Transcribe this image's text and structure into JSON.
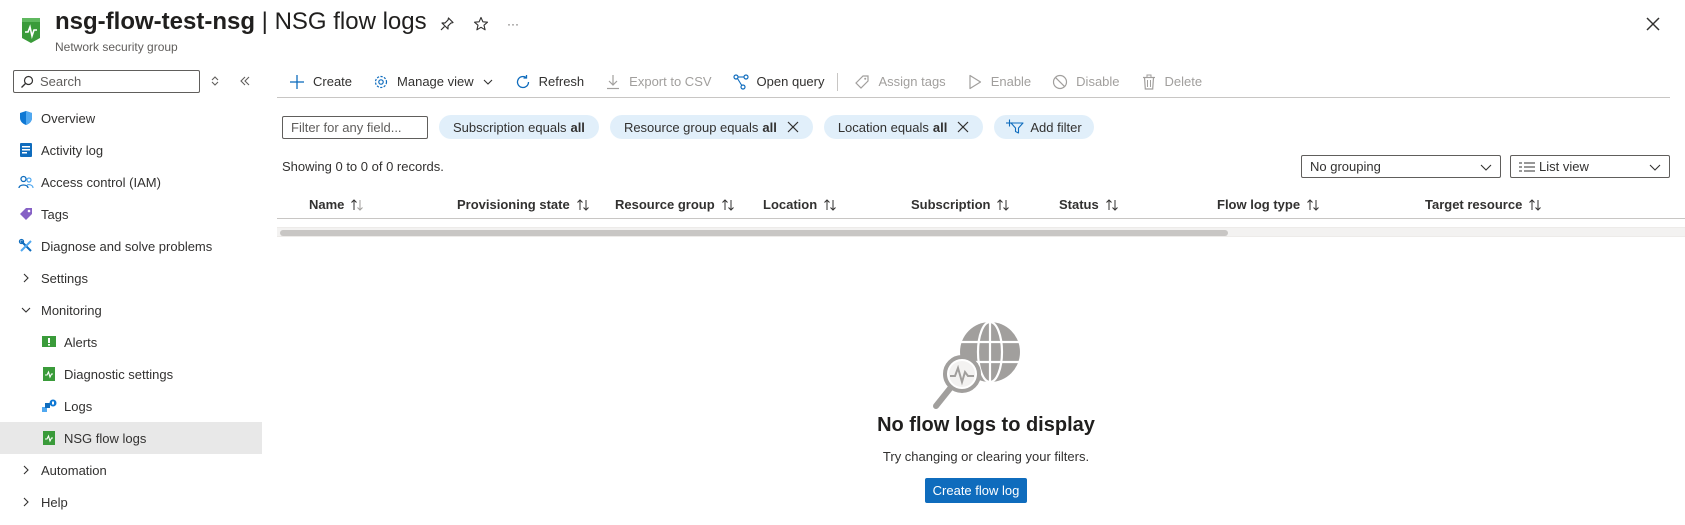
{
  "header": {
    "resource_name": "nsg-flow-test-nsg",
    "separator": "|",
    "page_name": "NSG flow logs",
    "subtitle": "Network security group",
    "more_label": "···"
  },
  "sidebar": {
    "search_placeholder": "Search",
    "items": [
      {
        "label": "Overview",
        "icon": "shield-icon"
      },
      {
        "label": "Activity log",
        "icon": "activity-log-icon"
      },
      {
        "label": "Access control (IAM)",
        "icon": "people-icon"
      },
      {
        "label": "Tags",
        "icon": "tag-icon"
      },
      {
        "label": "Diagnose and solve problems",
        "icon": "wrench-icon"
      },
      {
        "label": "Settings",
        "icon": "chevron-right-icon"
      },
      {
        "label": "Monitoring",
        "icon": "chevron-down-icon"
      },
      {
        "label": "Alerts",
        "icon": "alert-icon"
      },
      {
        "label": "Diagnostic settings",
        "icon": "diagnostic-settings-icon"
      },
      {
        "label": "Logs",
        "icon": "logs-icon"
      },
      {
        "label": "NSG flow logs",
        "icon": "nsg-flow-logs-icon"
      },
      {
        "label": "Automation",
        "icon": "chevron-right-icon"
      },
      {
        "label": "Help",
        "icon": "chevron-right-icon"
      }
    ]
  },
  "toolbar": {
    "create": "Create",
    "manage_view": "Manage view",
    "refresh": "Refresh",
    "export_csv": "Export to CSV",
    "open_query": "Open query",
    "assign_tags": "Assign tags",
    "enable": "Enable",
    "disable": "Disable",
    "delete": "Delete"
  },
  "filters": {
    "placeholder": "Filter for any field...",
    "subscription": {
      "label": "Subscription equals",
      "value": "all"
    },
    "resource_group": {
      "label": "Resource group equals",
      "value": "all"
    },
    "location": {
      "label": "Location equals",
      "value": "all"
    },
    "add_filter": "Add filter"
  },
  "records_text": "Showing 0 to 0 of 0 records.",
  "grouping": {
    "selected": "No grouping"
  },
  "view": {
    "selected": "List view"
  },
  "columns": [
    "Name",
    "Provisioning state",
    "Resource group",
    "Location",
    "Subscription",
    "Status",
    "Flow log type",
    "Target resource"
  ],
  "empty_state": {
    "title": "No flow logs to display",
    "subtitle": "Try changing or clearing your filters.",
    "button": "Create flow log"
  },
  "colors": {
    "accent": "#0f6cbd",
    "pill_bg": "#e1effa",
    "active_nav": "#e8e8e8"
  }
}
